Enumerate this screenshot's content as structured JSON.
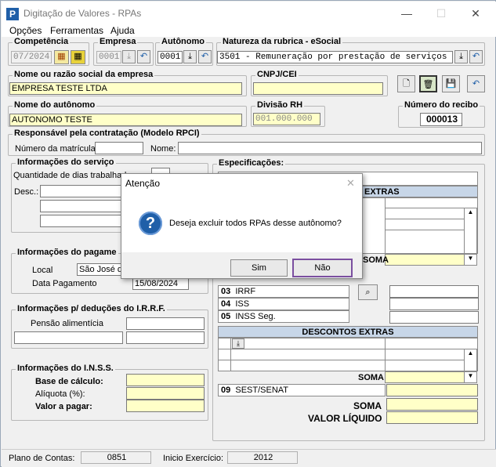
{
  "window": {
    "title": "Digitação de Valores - RPAs",
    "minimize": "—",
    "maximize": "☐",
    "close": "✕"
  },
  "menu": [
    "Opções",
    "Ferramentas",
    "Ajuda"
  ],
  "competencia": {
    "label": "Competência",
    "value": "07/2024"
  },
  "empresa": {
    "label": "Empresa",
    "value": "0001"
  },
  "autonomo_code": {
    "label": "Autônomo",
    "value": "0001"
  },
  "natureza": {
    "label": "Natureza da rubrica - eSocial",
    "value": "3501 - Remuneração por prestação de serviços"
  },
  "empresa_nome": {
    "label": "Nome ou razão social da empresa",
    "value": "EMPRESA TESTE LTDA"
  },
  "cnpj": {
    "label": "CNPJ/CEI",
    "value": ""
  },
  "autonomo_nome": {
    "label": "Nome do autônomo",
    "value": "AUTONOMO TESTE"
  },
  "divisao": {
    "label": "Divisão RH",
    "value": "001.000.000"
  },
  "recibo": {
    "label": "Número do recibo",
    "value": "000013"
  },
  "responsavel": {
    "label": "Responsável pela contratação (Modelo RPCI)",
    "matricula_label": "Número da matrícula:",
    "nome_label": "Nome:"
  },
  "servico": {
    "label": "Informações do serviço",
    "dias_label": "Quantidade de dias trabalhad",
    "desc_label": "Desc.:"
  },
  "pagamento": {
    "label": "Informações do pagame",
    "local_label": "Local",
    "local_value": "São José do",
    "data_label": "Data Pagamento",
    "data_value": "15/08/2024"
  },
  "irrf": {
    "label": "Informações p/ deduções do I.R.R.F.",
    "pensao_label": "Pensão alimentícia"
  },
  "inss": {
    "label": "Informações do I.N.S.S.",
    "base_label": "Base de cálculo:",
    "aliquota_label": "Alíquota (%):",
    "valor_label": "Valor a pagar:"
  },
  "especificacoes": {
    "label": "Especificações:",
    "extras_header": "EXTRAS",
    "soma_label": "SOMA",
    "descontos": [
      {
        "code": "03",
        "name": "IRRF"
      },
      {
        "code": "04",
        "name": "ISS"
      },
      {
        "code": "05",
        "name": "INSS Seg."
      }
    ],
    "descontos_extras_header": "DESCONTOS EXTRAS",
    "soma2_label": "SOMA",
    "sest": {
      "code": "09",
      "name": "SEST/SENAT"
    },
    "soma_final_label": "SOMA",
    "liquido_label": "VALOR LÍQUIDO"
  },
  "status": {
    "plano_label": "Plano de Contas:",
    "plano_value": "0851",
    "exercicio_label": "Inicio Exercício:",
    "exercicio_value": "2012"
  },
  "dialog": {
    "title": "Atenção",
    "message": "Deseja excluir todos RPAs desse autônomo?",
    "yes": "Sim",
    "no": "Não",
    "close": "✕",
    "icon": "question-icon"
  },
  "colors": {
    "yellow_field": "#ffffc8",
    "table_header": "#c7d6e8",
    "dialog_focus": "#7b4fa0",
    "question_icon": "#1f5fa8"
  }
}
